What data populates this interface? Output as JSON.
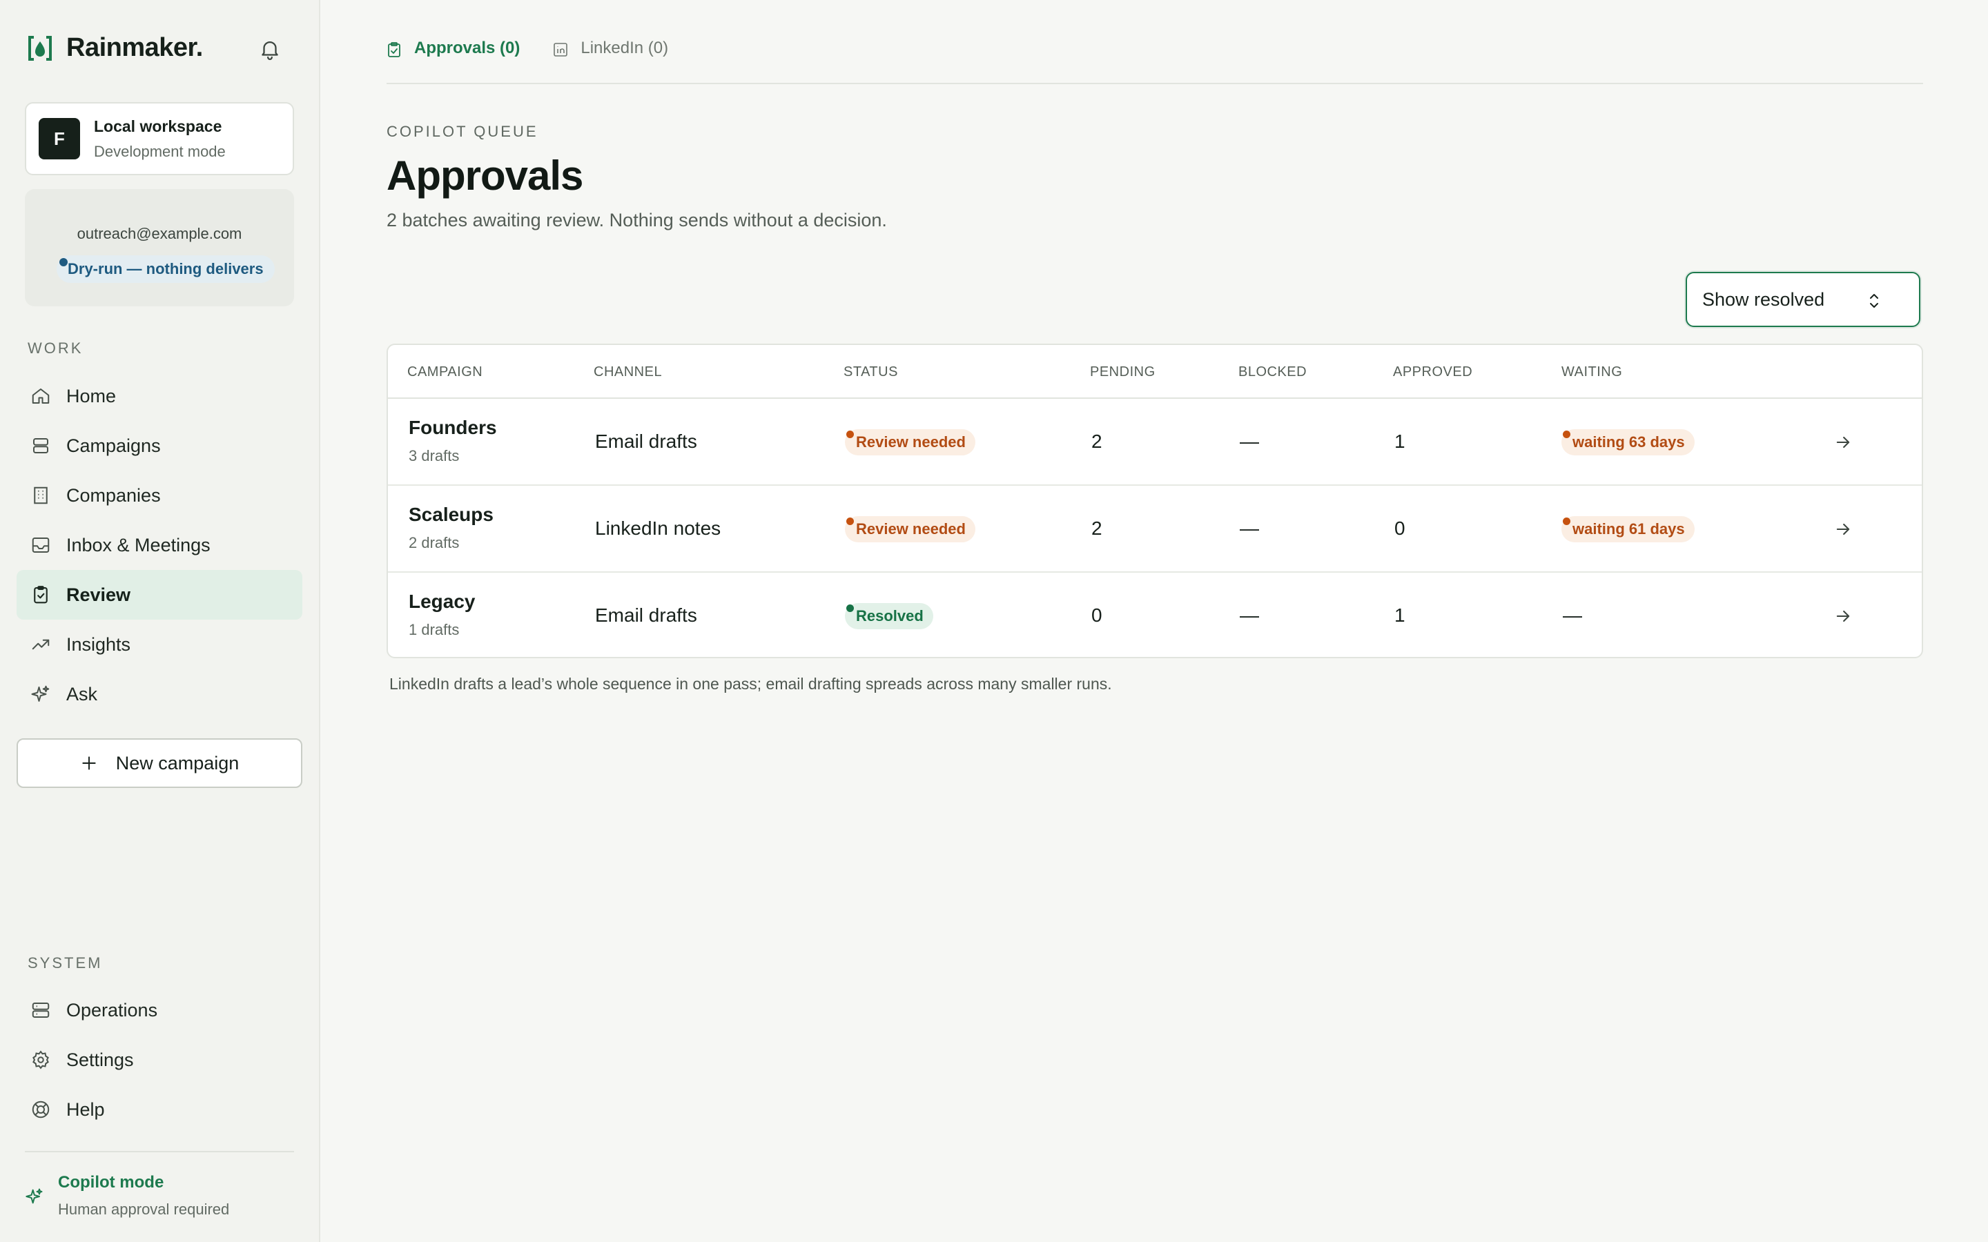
{
  "brand": {
    "name": "Rainmaker."
  },
  "workspace": {
    "initial": "F",
    "name": "Local workspace",
    "mode": "Development mode"
  },
  "sender": {
    "email": "outreach@example.com",
    "status": "Dry-run — nothing delivers"
  },
  "nav": {
    "work_label": "WORK",
    "work_items": [
      {
        "label": "Home",
        "icon": "home-icon"
      },
      {
        "label": "Campaigns",
        "icon": "stack-icon"
      },
      {
        "label": "Companies",
        "icon": "building-icon"
      },
      {
        "label": "Inbox & Meetings",
        "icon": "inbox-icon"
      },
      {
        "label": "Review",
        "icon": "clipboard-check-icon",
        "active": true
      },
      {
        "label": "Insights",
        "icon": "trend-icon"
      },
      {
        "label": "Ask",
        "icon": "sparkles-icon"
      }
    ],
    "new_campaign_label": "New campaign",
    "system_label": "SYSTEM",
    "system_items": [
      {
        "label": "Operations",
        "icon": "server-icon"
      },
      {
        "label": "Settings",
        "icon": "gear-icon"
      },
      {
        "label": "Help",
        "icon": "lifebuoy-icon"
      }
    ]
  },
  "copilot": {
    "title": "Copilot mode",
    "subtitle": "Human approval required"
  },
  "tabs": [
    {
      "label": "Approvals (0)",
      "icon": "clipboard-check-icon",
      "active": true
    },
    {
      "label": "LinkedIn (0)",
      "icon": "linkedin-icon",
      "active": false
    }
  ],
  "page": {
    "eyebrow": "COPILOT QUEUE",
    "title": "Approvals",
    "subtitle": "2 batches awaiting review. Nothing sends without a decision."
  },
  "filter": {
    "selected": "Show resolved"
  },
  "table": {
    "columns": [
      "CAMPAIGN",
      "CHANNEL",
      "STATUS",
      "PENDING",
      "BLOCKED",
      "APPROVED",
      "WAITING"
    ],
    "rows": [
      {
        "campaign": "Founders",
        "drafts": "3 drafts",
        "channel": "Email drafts",
        "status": "Review needed",
        "status_kind": "warn",
        "pending": "2",
        "blocked": "—",
        "approved": "1",
        "waiting": "waiting 63 days",
        "waiting_kind": "warn"
      },
      {
        "campaign": "Scaleups",
        "drafts": "2 drafts",
        "channel": "LinkedIn notes",
        "status": "Review needed",
        "status_kind": "warn",
        "pending": "2",
        "blocked": "—",
        "approved": "0",
        "waiting": "waiting 61 days",
        "waiting_kind": "warn"
      },
      {
        "campaign": "Legacy",
        "drafts": "1 drafts",
        "channel": "Email drafts",
        "status": "Resolved",
        "status_kind": "ok",
        "pending": "0",
        "blocked": "—",
        "approved": "1",
        "waiting": "—",
        "waiting_kind": "none"
      }
    ]
  },
  "footnote": "LinkedIn drafts a lead’s whole sequence in one pass; email drafting spreads across many smaller runs.",
  "colors": {
    "accent": "#1d7a4e",
    "warn": "#b24c14",
    "info": "#1e5a80"
  }
}
